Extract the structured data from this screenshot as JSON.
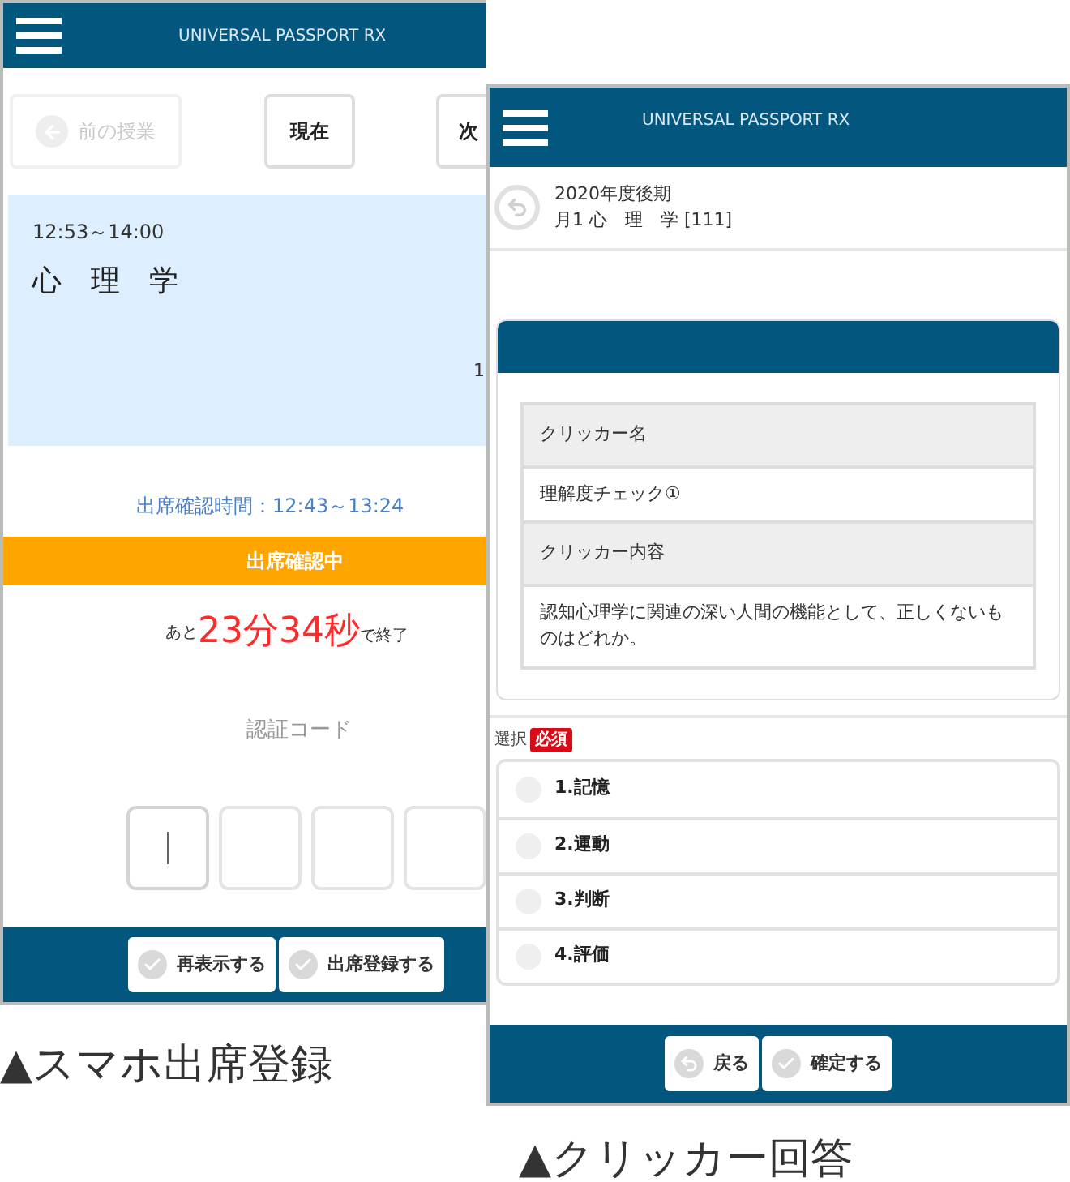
{
  "attendance_screen": {
    "app_title": "UNIVERSAL PASSPORT RX",
    "nav_buttons": [
      {
        "label": "前の授業",
        "disabled": true
      },
      {
        "label": "現在",
        "disabled": false
      },
      {
        "label": "次",
        "disabled": false
      }
    ],
    "lesson": {
      "time": "12:53～14:00",
      "name": "心　理　学",
      "column_2": "1"
    },
    "check_period": "出席確認時間：12:43～13:24",
    "status_banner": "出席確認中",
    "countdown": {
      "prefix": "あと",
      "remaining": "23分34秒",
      "suffix": "で終了"
    },
    "code_label": "認証コード",
    "code_boxes": [
      {
        "focused": true
      },
      {
        "focused": false
      },
      {
        "focused": false
      },
      {
        "focused": false
      }
    ],
    "footer_buttons": [
      "再表示する",
      "出席登録する"
    ]
  },
  "attendance_caption": "▲スマホ出席登録",
  "clicker_screen": {
    "app_title": "UNIVERSAL PASSPORT RX",
    "term": "2020年度後期",
    "course": "月1 心　理　学 [111]",
    "details": [
      {
        "kind": "label",
        "text": "クリッカー名"
      },
      {
        "kind": "value",
        "text": "理解度チェック①"
      },
      {
        "kind": "label",
        "text": "クリッカー内容"
      },
      {
        "kind": "value",
        "text": "認知心理学に関連の深い人間の機能として、正しくないものはどれか。"
      }
    ],
    "choice_label": "選択",
    "required_badge": "必須",
    "options": [
      {
        "label": "1.記憶",
        "selected": false
      },
      {
        "label": "2.運動",
        "selected": false
      },
      {
        "label": "3.判断",
        "selected": false
      },
      {
        "label": "4.評価",
        "selected": false
      }
    ],
    "footer_buttons": [
      "戻る",
      "確定する"
    ]
  },
  "clicker_caption": "▲クリッカー回答"
}
